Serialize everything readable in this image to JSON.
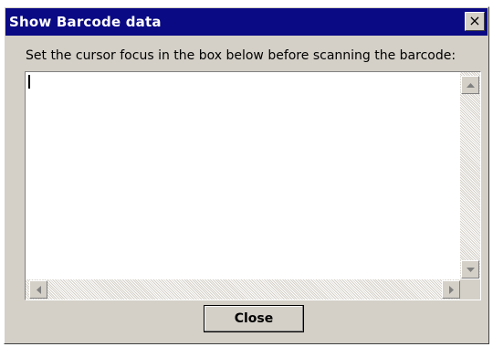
{
  "window": {
    "title": "Show Barcode data",
    "close_glyph": "×",
    "close_icon": "close-icon"
  },
  "main": {
    "instruction": "Set the cursor focus in the box below before scanning the barcode:",
    "barcode_value": ""
  },
  "buttons": {
    "close_label": "Close"
  },
  "colors": {
    "titlebar": "#0a0a84",
    "face": "#d4d0c8",
    "field": "#ffffff"
  }
}
